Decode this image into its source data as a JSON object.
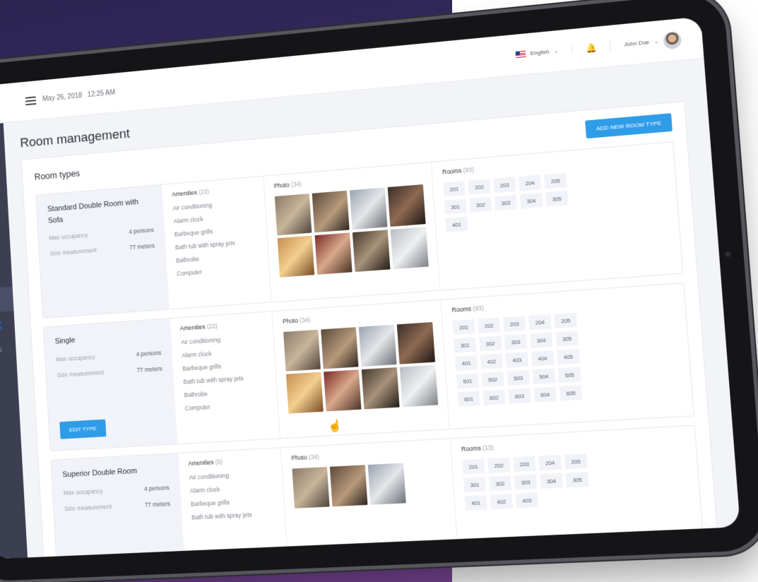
{
  "topbar": {
    "date": "May 26, 2018",
    "time": "12:25 AM",
    "language": "English",
    "user_name": "John Doe"
  },
  "page": {
    "title": "Room management",
    "section_title": "Room types",
    "add_button": "ADD NEW ROOM TYPE"
  },
  "labels": {
    "max_occupancy": "Max occupancy",
    "size_measurement": "Size measurement",
    "amenities": "Amenities",
    "photo": "Photo",
    "rooms": "Rooms",
    "edit_type": "EDIT TYPE"
  },
  "room_types": [
    {
      "name": "Standard Double Room with Sofa",
      "max_occupancy": "4 persons",
      "size": "77 meters",
      "amenities_count": "(22)",
      "amenities": [
        "Air conditioning",
        "Alarm clock",
        "Barbeque grills",
        "Bath tub with spray jets",
        "Bathrobe",
        "Computer"
      ],
      "photo_count": "(34)",
      "rooms_count": "(93)",
      "rooms": [
        "201",
        "202",
        "203",
        "204",
        "205",
        "301",
        "302",
        "303",
        "304",
        "305",
        "401"
      ]
    },
    {
      "name": "Single",
      "max_occupancy": "4 persons",
      "size": "77 meters",
      "amenities_count": "(22)",
      "amenities": [
        "Air conditioning",
        "Alarm clock",
        "Barbeque grills",
        "Bath tub with spray jets",
        "Bathrobe",
        "Computer"
      ],
      "photo_count": "(34)",
      "rooms_count": "(93)",
      "rooms": [
        "201",
        "202",
        "203",
        "204",
        "205",
        "301",
        "302",
        "303",
        "304",
        "305",
        "401",
        "402",
        "403",
        "404",
        "405",
        "501",
        "502",
        "503",
        "504",
        "505",
        "601",
        "602",
        "603",
        "604",
        "605"
      ]
    },
    {
      "name": "Superior Double Room",
      "max_occupancy": "4 persons",
      "size": "77 meters",
      "amenities_count": "(5)",
      "amenities": [
        "Air conditioning",
        "Alarm clock",
        "Barbeque grills",
        "Bath tub with spray jets"
      ],
      "photo_count": "(34)",
      "rooms_count": "(13)",
      "rooms": [
        "201",
        "202",
        "203",
        "204",
        "205",
        "301",
        "302",
        "303",
        "304",
        "305",
        "401",
        "402",
        "403"
      ]
    }
  ],
  "sidebar_icons": [
    "document-icon",
    "info-icon",
    "calendar-icon",
    "users-icon",
    "star-icon",
    "table-icon",
    "room-types-icon",
    "guests-icon",
    "profile-icon"
  ],
  "colors": {
    "accent": "#2f9ce8",
    "sidebar": "#3c3f52",
    "card_info_bg": "#f1f3f8"
  }
}
